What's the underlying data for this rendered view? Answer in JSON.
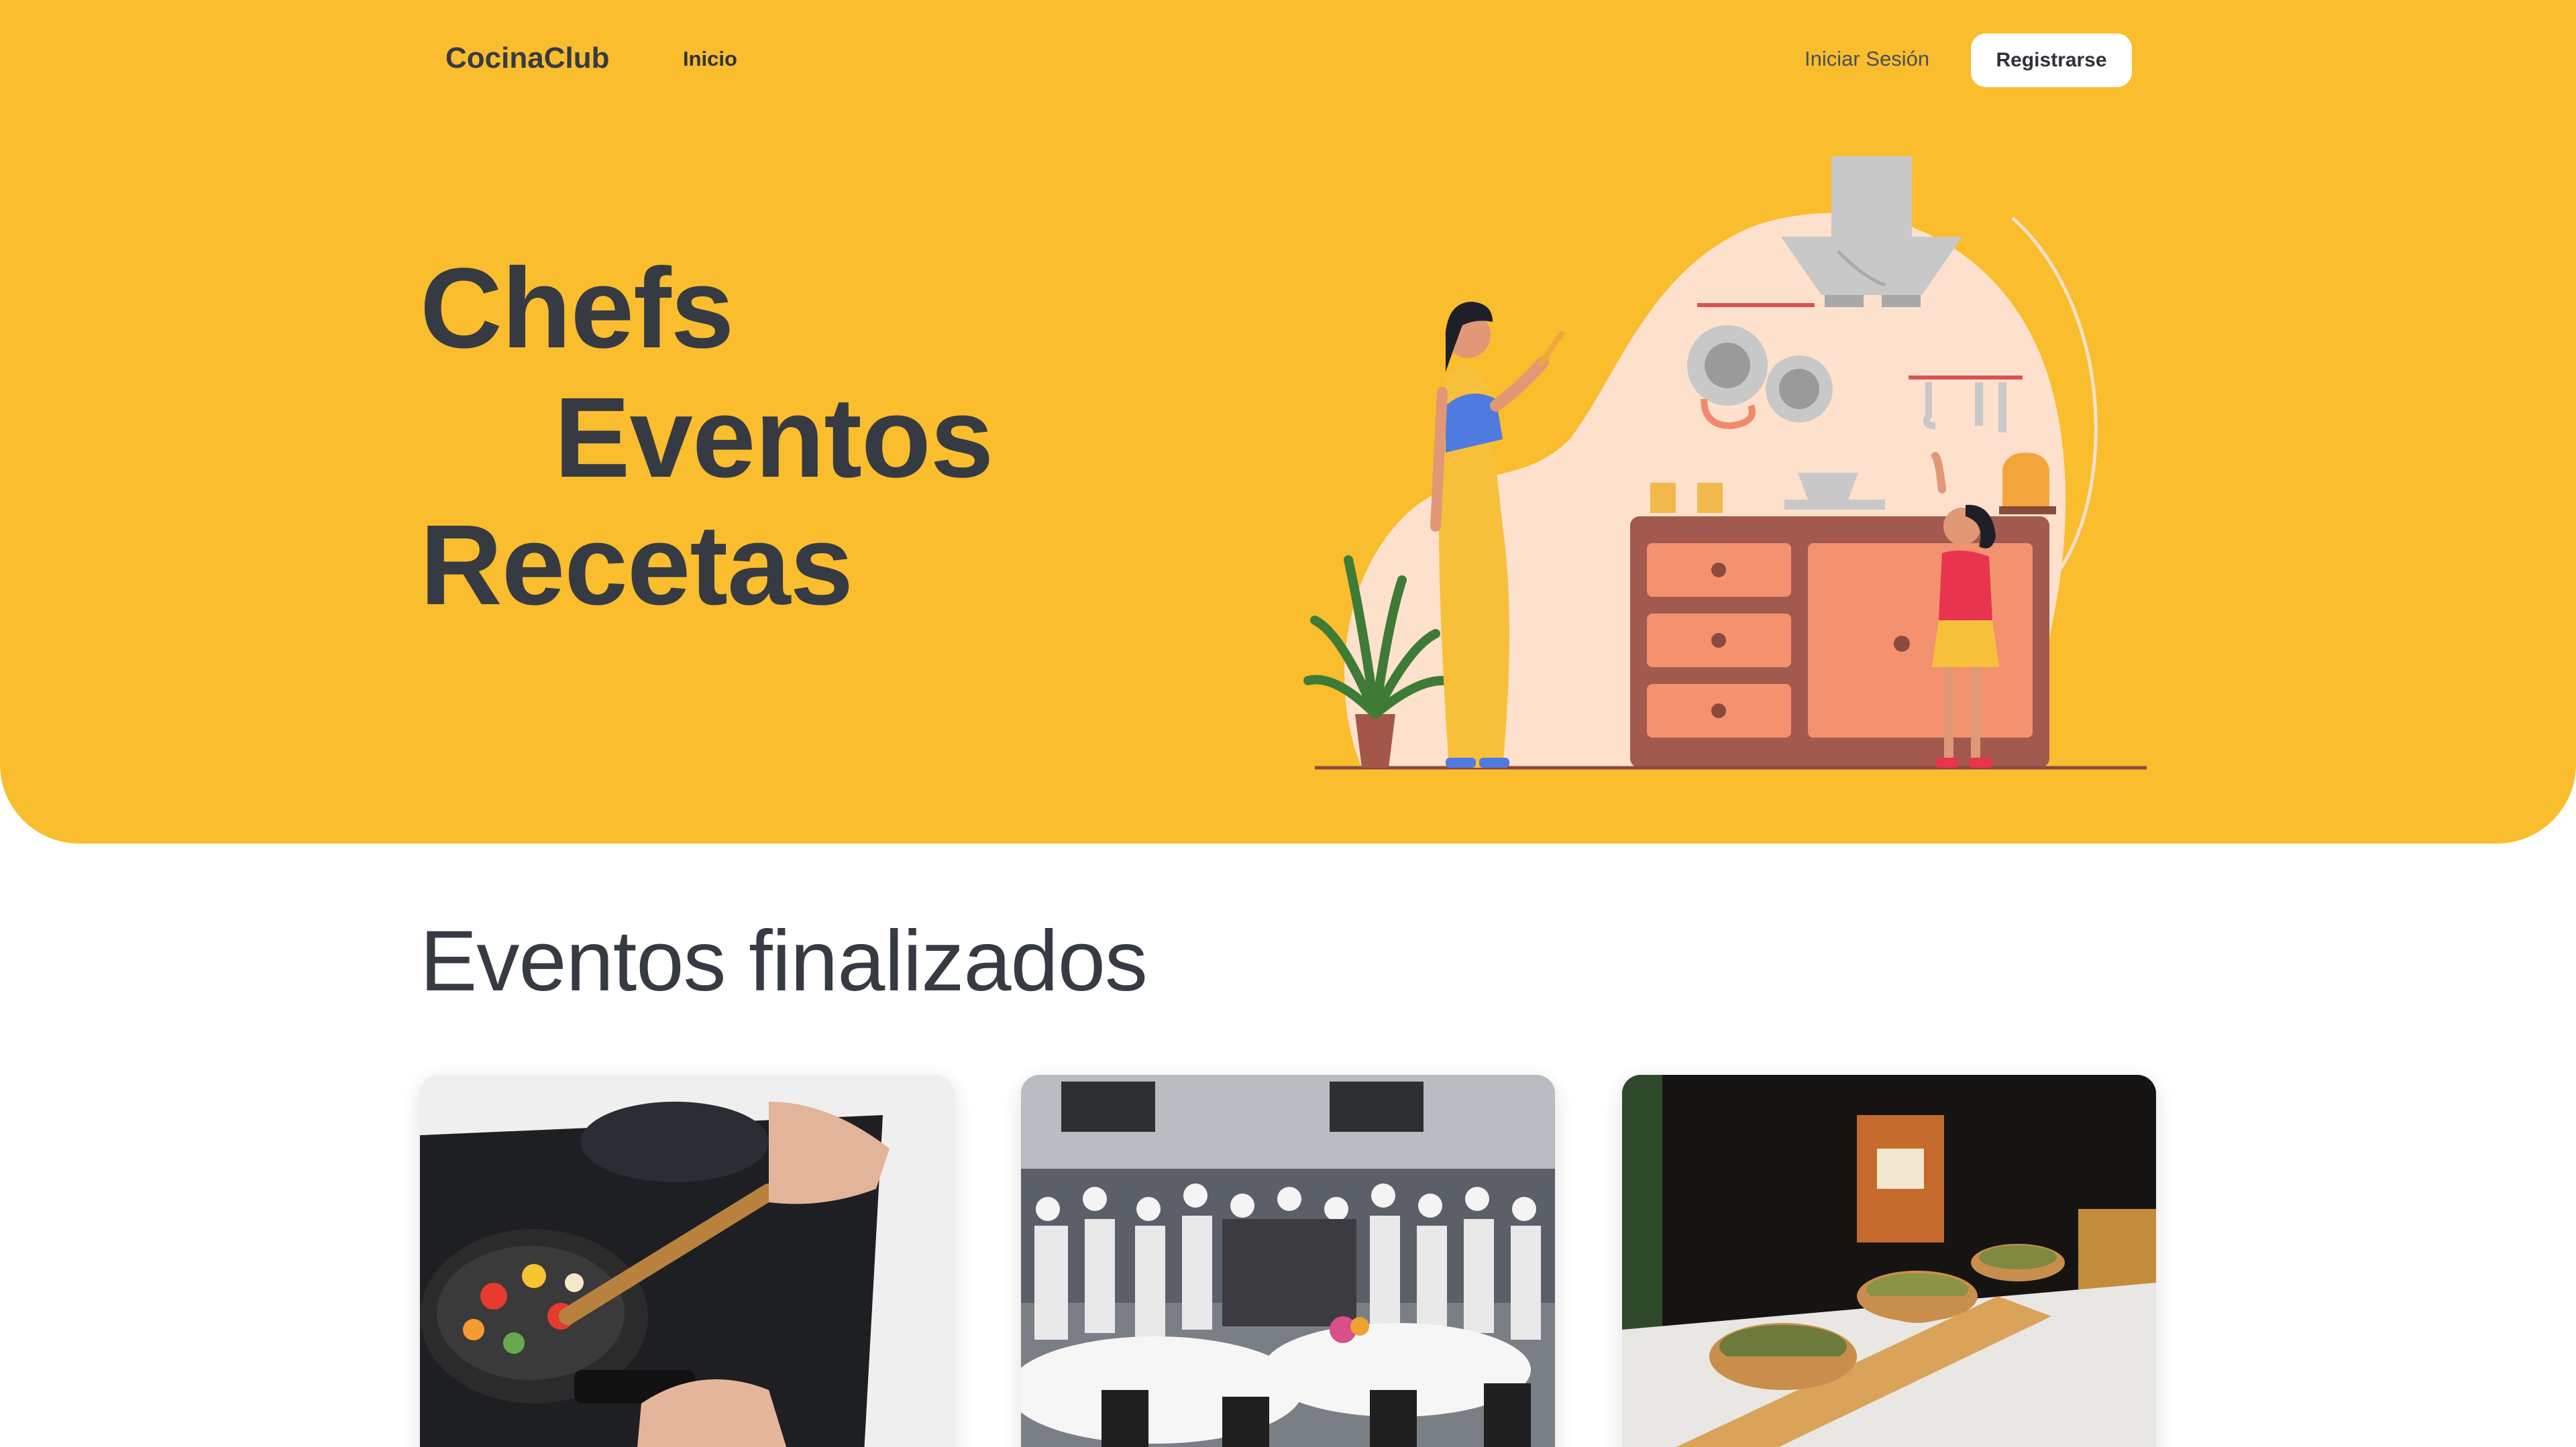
{
  "nav": {
    "brand": "CocinaClub",
    "home_link": "Inicio",
    "login_link": "Iniciar Sesión",
    "register_button": "Registrarse"
  },
  "hero": {
    "words": [
      "Chefs",
      "Eventos",
      "Recetas"
    ],
    "illustration_icon": "kitchen-illustration-icon"
  },
  "section": {
    "title": "Eventos finalizados"
  },
  "events": [
    {
      "image_icon": "cooking-pan-photo-icon"
    },
    {
      "image_icon": "chefs-banquet-photo-icon"
    },
    {
      "image_icon": "food-bowls-photo-icon"
    }
  ],
  "colors": {
    "accent": "#f9bd2d",
    "text": "#363a43",
    "background": "#ffffff"
  }
}
